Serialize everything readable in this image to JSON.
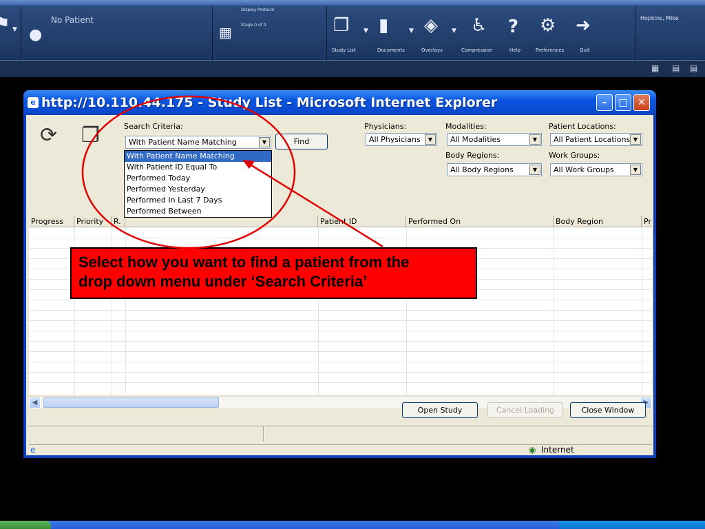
{
  "app": {
    "patient": "No Patient",
    "display_protocol": "Display Protocol",
    "stage": "Stage 0 of 0",
    "user": "Hopkins, Mike",
    "toolbar": {
      "study_list": "Study List",
      "documents": "Documents",
      "overlays": "Overlays",
      "compression": "Compression",
      "help": "Help",
      "preferences": "Preferences",
      "quit": "Quit"
    }
  },
  "window": {
    "title": "http://10.110.44.175 - Study List - Microsoft Internet Explorer",
    "status_zone": "Internet"
  },
  "search": {
    "criteria_label": "Search Criteria:",
    "criteria_value": "With Patient Name Matching",
    "find_label": "Find",
    "dropdown_options": [
      "With Patient Name Matching",
      "With Patient ID Equal To",
      "Performed Today",
      "Performed Yesterday",
      "Performed In Last 7 Days",
      "Performed Between"
    ]
  },
  "filters": {
    "physicians_label": "Physicians:",
    "physicians_value": "All Physicians",
    "modalities_label": "Modalities:",
    "modalities_value": "All Modalities",
    "body_regions_label": "Body Regions:",
    "body_regions_value": "All Body Regions",
    "locations_label": "Patient Locations:",
    "locations_value": "All Patient Locations",
    "work_groups_label": "Work Groups:",
    "work_groups_value": "All Work Groups"
  },
  "table": {
    "columns": [
      "Progress",
      "Priority",
      "R.",
      "Patient ID",
      "Performed On",
      "Body Region",
      "Pr"
    ]
  },
  "buttons": {
    "open_study": "Open Study",
    "cancel_loading": "Cancel Loading",
    "close_window": "Close Window"
  },
  "annotation": {
    "callout_line1": "Select how you want to find a patient from the",
    "callout_line2": "drop down menu under ‘Search Criteria’",
    "color": "#ff0000"
  }
}
